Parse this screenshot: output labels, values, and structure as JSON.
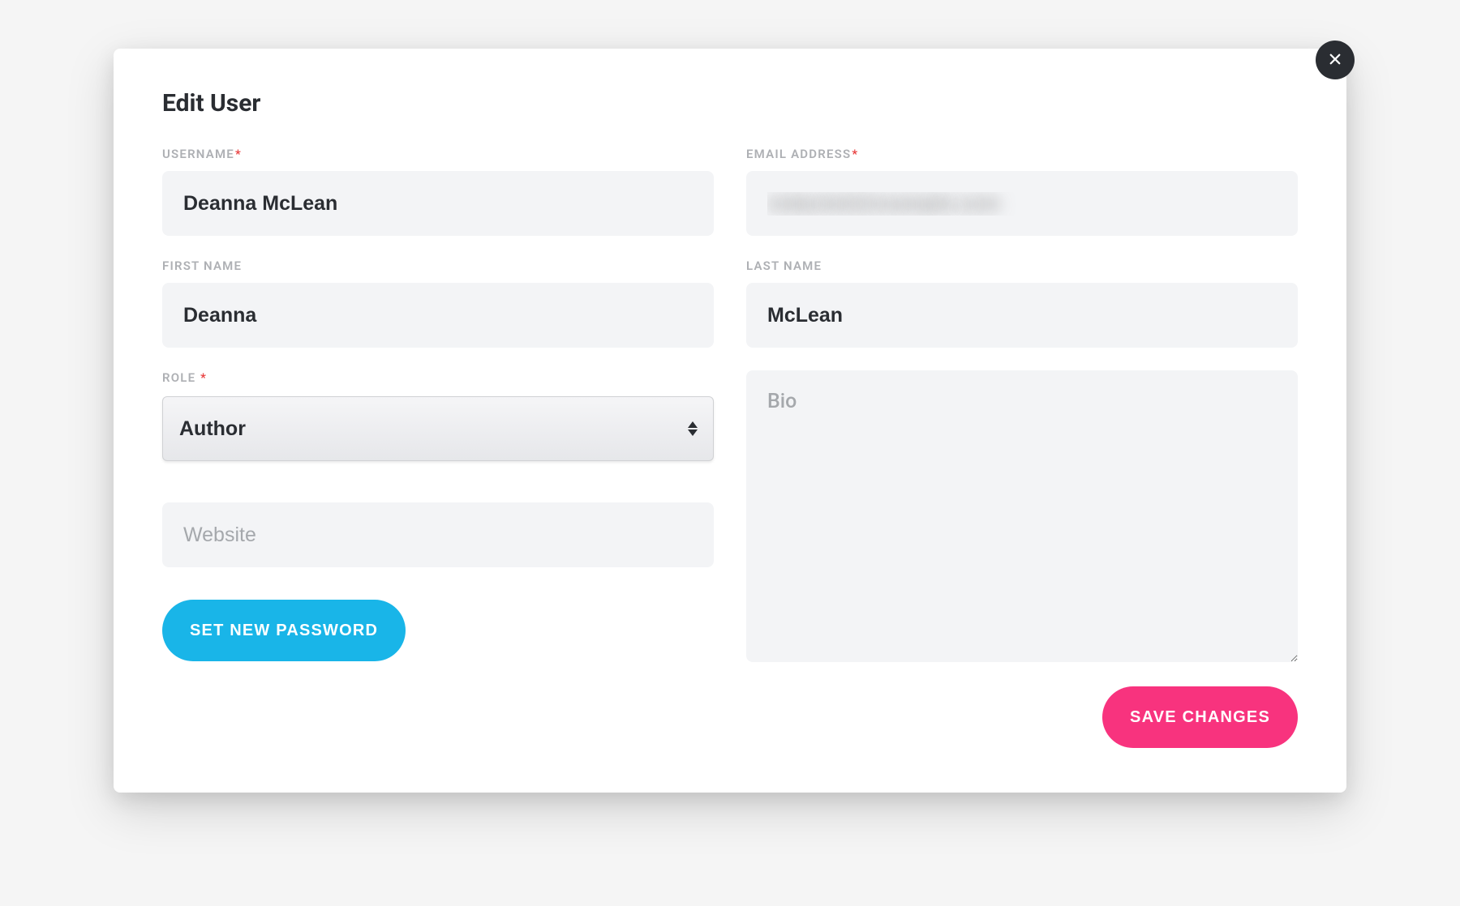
{
  "modal": {
    "title": "Edit User",
    "close_label": "Close"
  },
  "form": {
    "username": {
      "label": "Username",
      "required": true,
      "value": "Deanna McLean"
    },
    "email": {
      "label": "Email Address",
      "required": true,
      "value": "redacted@example.com"
    },
    "first_name": {
      "label": "First Name",
      "value": "Deanna"
    },
    "last_name": {
      "label": "Last Name",
      "value": "McLean"
    },
    "role": {
      "label": "Role ",
      "required": true,
      "value": "Author"
    },
    "website": {
      "placeholder": "Website",
      "value": ""
    },
    "bio": {
      "placeholder": "Bio",
      "value": ""
    }
  },
  "buttons": {
    "set_password": "Set New Password",
    "save": "Save Changes"
  }
}
